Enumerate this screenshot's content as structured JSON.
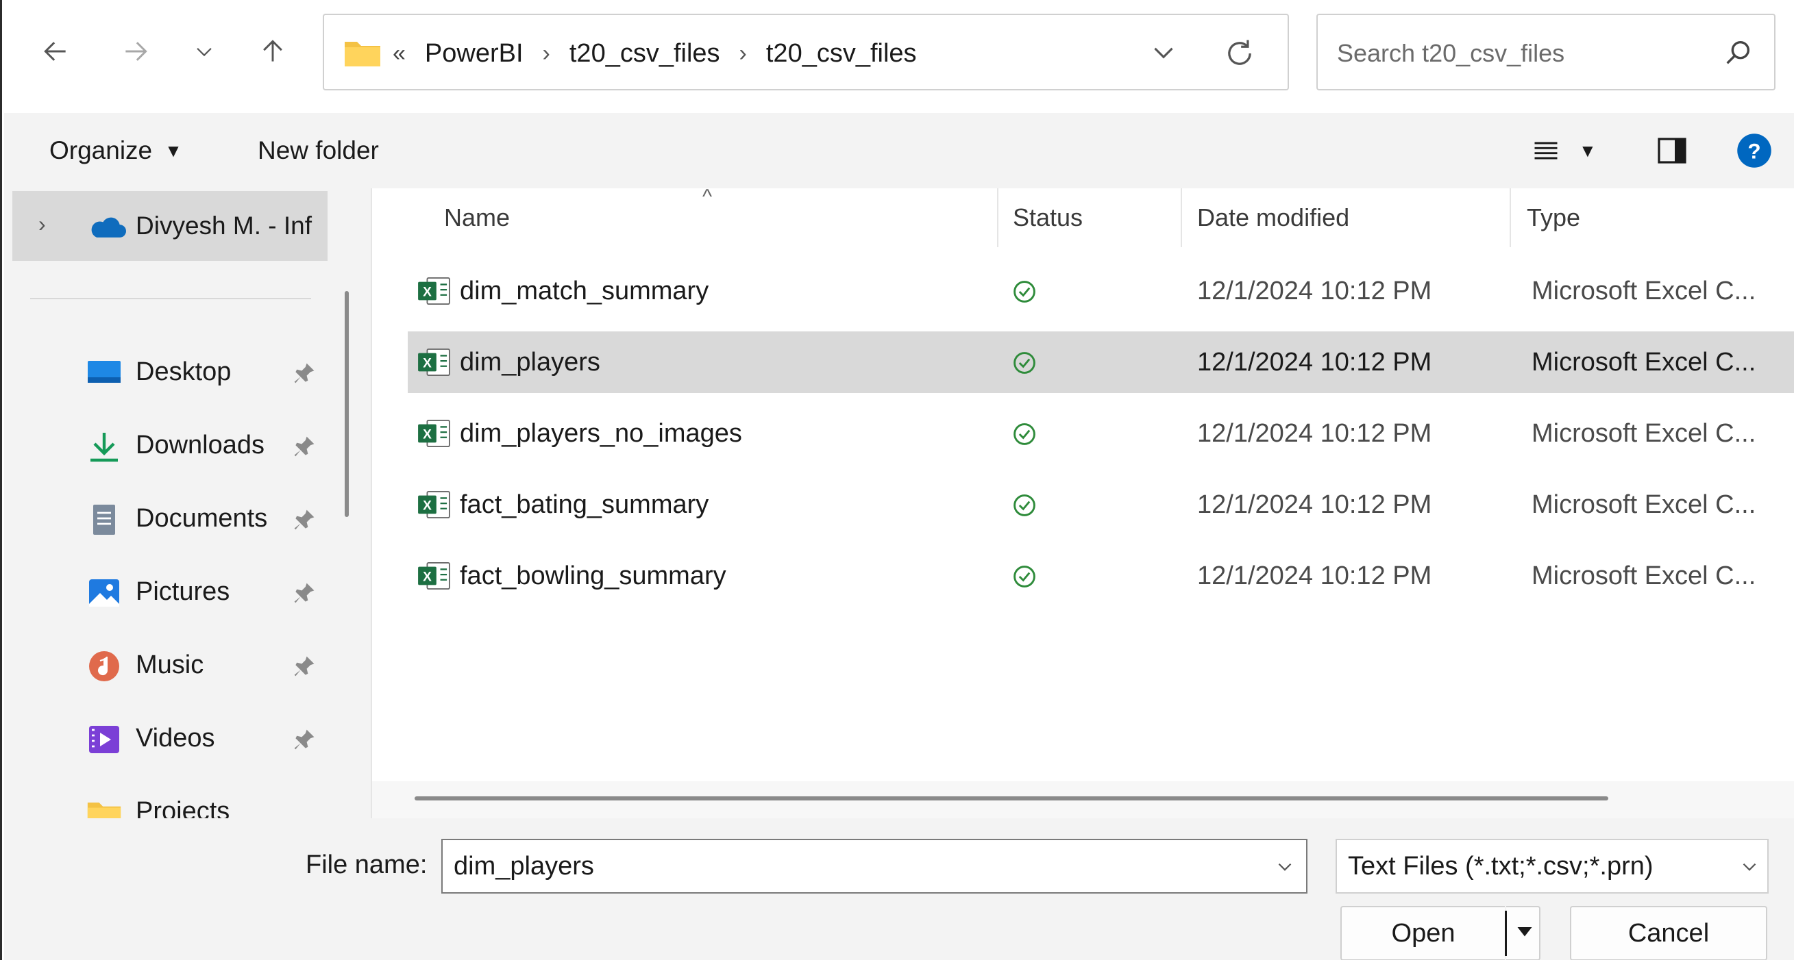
{
  "window": {
    "breadcrumb": [
      "PowerBI",
      "t20_csv_files",
      "t20_csv_files"
    ],
    "breadcrumb_overflow": "«",
    "search_placeholder": "Search t20_csv_files"
  },
  "toolbar": {
    "organize_label": "Organize",
    "new_folder_label": "New folder"
  },
  "nav": {
    "onedrive_label": "Divyesh M. - Inf",
    "items": [
      {
        "label": "Desktop",
        "icon": "desktop-icon"
      },
      {
        "label": "Downloads",
        "icon": "downloads-icon"
      },
      {
        "label": "Documents",
        "icon": "documents-icon"
      },
      {
        "label": "Pictures",
        "icon": "pictures-icon"
      },
      {
        "label": "Music",
        "icon": "music-icon"
      },
      {
        "label": "Videos",
        "icon": "videos-icon"
      },
      {
        "label": "Projects",
        "icon": "folder-icon"
      }
    ]
  },
  "columns": {
    "name": "Name",
    "status": "Status",
    "date": "Date modified",
    "type": "Type"
  },
  "files": [
    {
      "name": "dim_match_summary",
      "date": "12/1/2024 10:12 PM",
      "type": "Microsoft Excel C...",
      "selected": false
    },
    {
      "name": "dim_players",
      "date": "12/1/2024 10:12 PM",
      "type": "Microsoft Excel C...",
      "selected": true
    },
    {
      "name": "dim_players_no_images",
      "date": "12/1/2024 10:12 PM",
      "type": "Microsoft Excel C...",
      "selected": false
    },
    {
      "name": "fact_bating_summary",
      "date": "12/1/2024 10:12 PM",
      "type": "Microsoft Excel C...",
      "selected": false
    },
    {
      "name": "fact_bowling_summary",
      "date": "12/1/2024 10:12 PM",
      "type": "Microsoft Excel C...",
      "selected": false
    }
  ],
  "footer": {
    "file_name_label": "File name:",
    "file_name_value": "dim_players",
    "file_type": "Text Files (*.txt;*.csv;*.prn)",
    "open_label": "Open",
    "cancel_label": "Cancel"
  },
  "colors": {
    "accent": "#0067c0",
    "selection": "#d9d9d9",
    "excel_green": "#1d6f42",
    "status_green": "#2e8b3a"
  }
}
